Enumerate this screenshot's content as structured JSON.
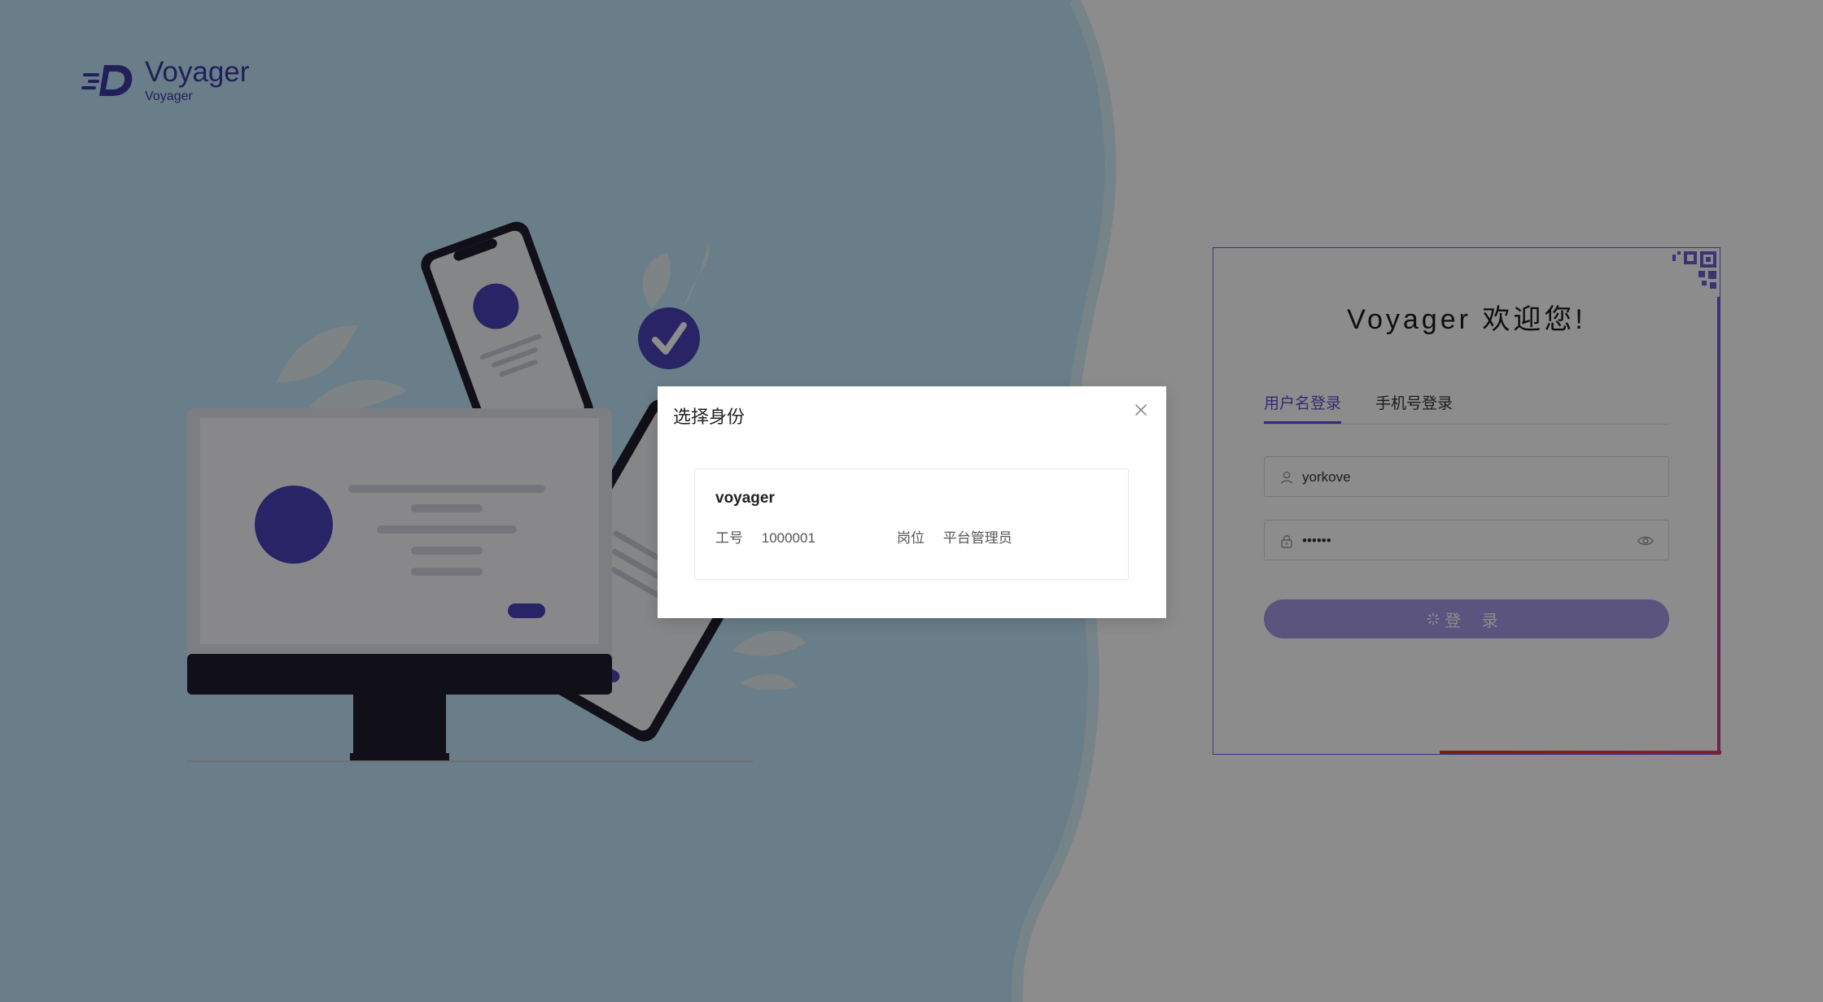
{
  "logo": {
    "name": "Voyager",
    "sub": "Voyager"
  },
  "login": {
    "title": "Voyager 欢迎您!",
    "tabs": [
      {
        "label": "用户名登录",
        "active": true
      },
      {
        "label": "手机号登录",
        "active": false
      }
    ],
    "username": {
      "value": "yorkove"
    },
    "password": {
      "value": "••••••"
    },
    "submit_label": "登 录"
  },
  "modal": {
    "title": "选择身份",
    "identity": {
      "name": "voyager",
      "employee_id_label": "工号",
      "employee_id": "1000001",
      "position_label": "岗位",
      "position": "平台管理员"
    }
  },
  "colors": {
    "accent": "#5b4fd0",
    "illustration_purple": "#4a43b8",
    "left_bg": "#b7e0f4"
  }
}
